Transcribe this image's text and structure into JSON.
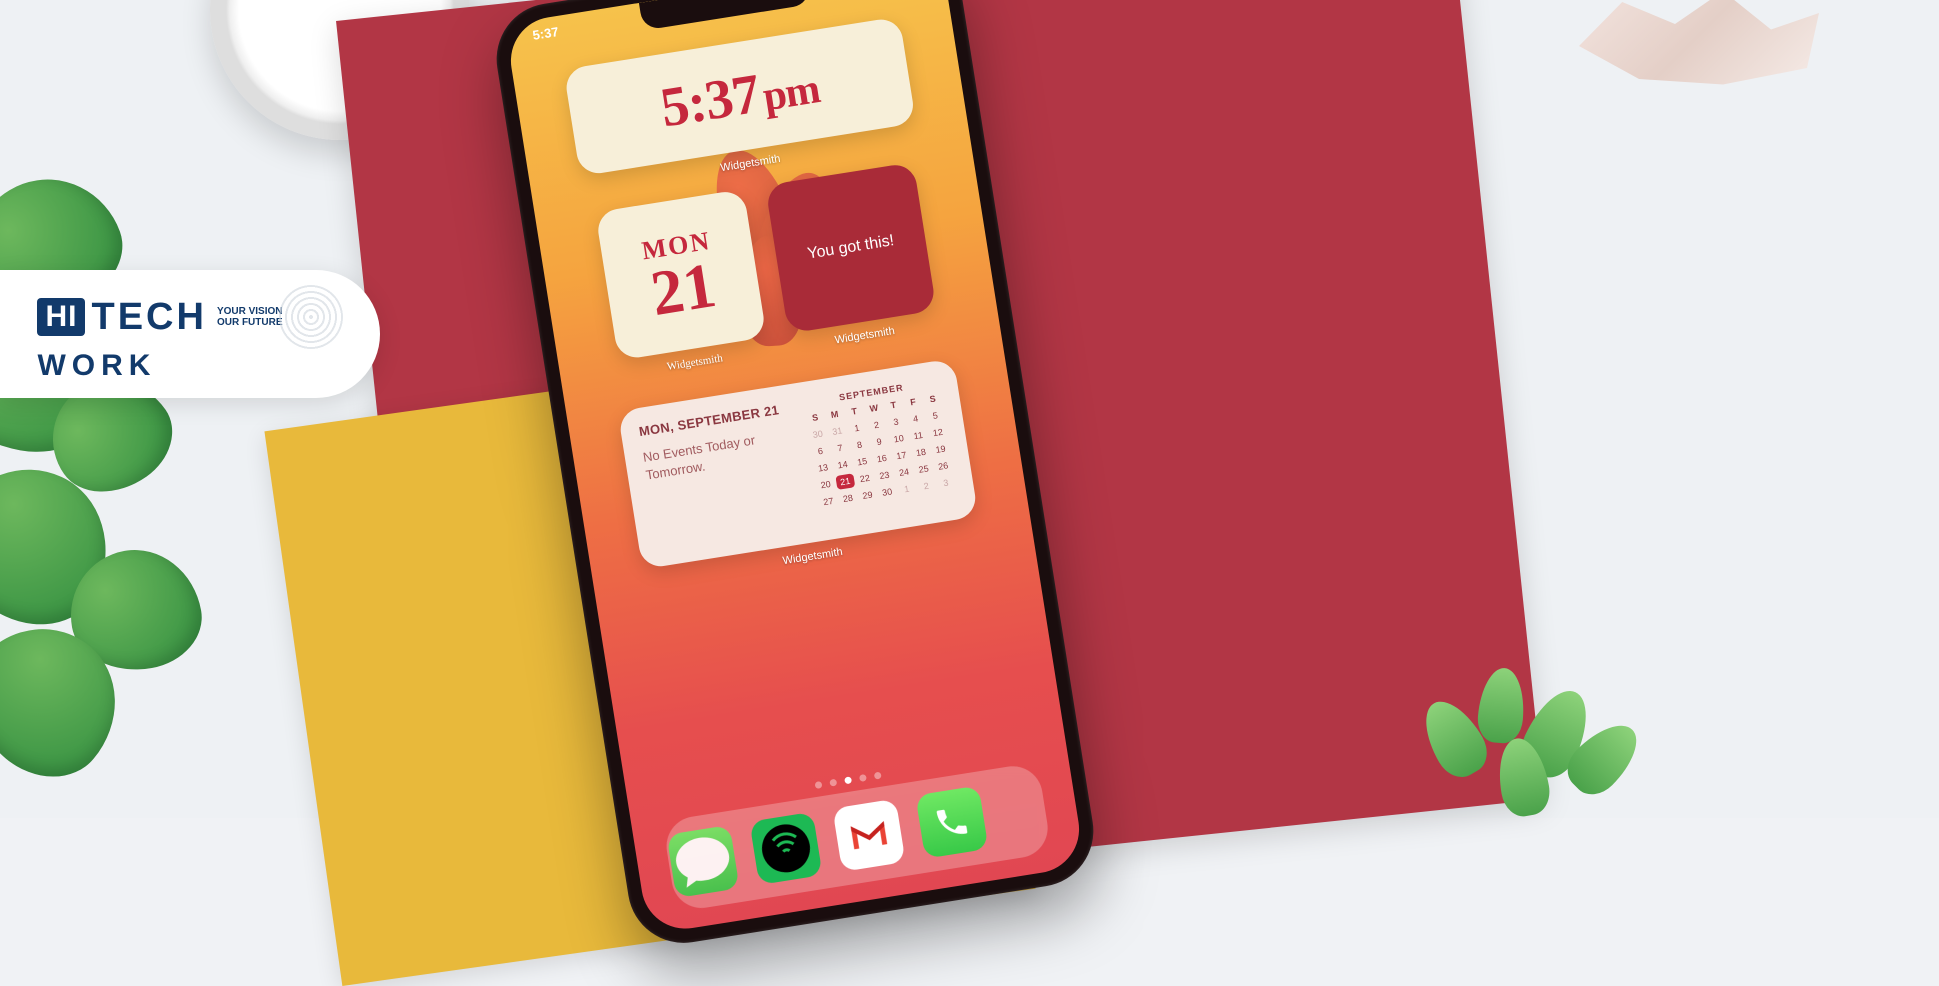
{
  "colors": {
    "accent_red": "#c5283d",
    "cream": "#f7efd9",
    "deep_red": "#a92b38",
    "pale": "#f6e8e2",
    "spotify_green": "#1db954",
    "ios_green": "#38c948"
  },
  "statusbar": {
    "time": "5:37"
  },
  "widgets": {
    "app_label": "Widgetsmith",
    "time": {
      "value": "5:37",
      "suffix": "pm"
    },
    "date": {
      "dow": "MON",
      "day": "21"
    },
    "quote": {
      "text": "You got this!"
    },
    "calendar": {
      "title": "MON, SEPTEMBER 21",
      "events": "No Events Today or Tomorrow.",
      "month": "SEPTEMBER",
      "dow": [
        "S",
        "M",
        "T",
        "W",
        "T",
        "F",
        "S"
      ],
      "leading_dim": [
        "30",
        "31"
      ],
      "days": [
        "1",
        "2",
        "3",
        "4",
        "5",
        "6",
        "7",
        "8",
        "9",
        "10",
        "11",
        "12",
        "13",
        "14",
        "15",
        "16",
        "17",
        "18",
        "19",
        "20",
        "21",
        "22",
        "23",
        "24",
        "25",
        "26",
        "27",
        "28",
        "29",
        "30"
      ],
      "trailing_dim": [
        "1",
        "2",
        "3"
      ],
      "today": "21"
    }
  },
  "dock": {
    "apps": [
      {
        "name": "messages"
      },
      {
        "name": "spotify"
      },
      {
        "name": "gmail",
        "letter": "M"
      },
      {
        "name": "phone"
      }
    ]
  },
  "page_indicator": {
    "count": 5,
    "active": 2
  },
  "logo": {
    "hi": "HI",
    "tech": "TECH",
    "work": "WORK",
    "tag1": "YOUR VISION",
    "tag2": "OUR FUTURE"
  }
}
